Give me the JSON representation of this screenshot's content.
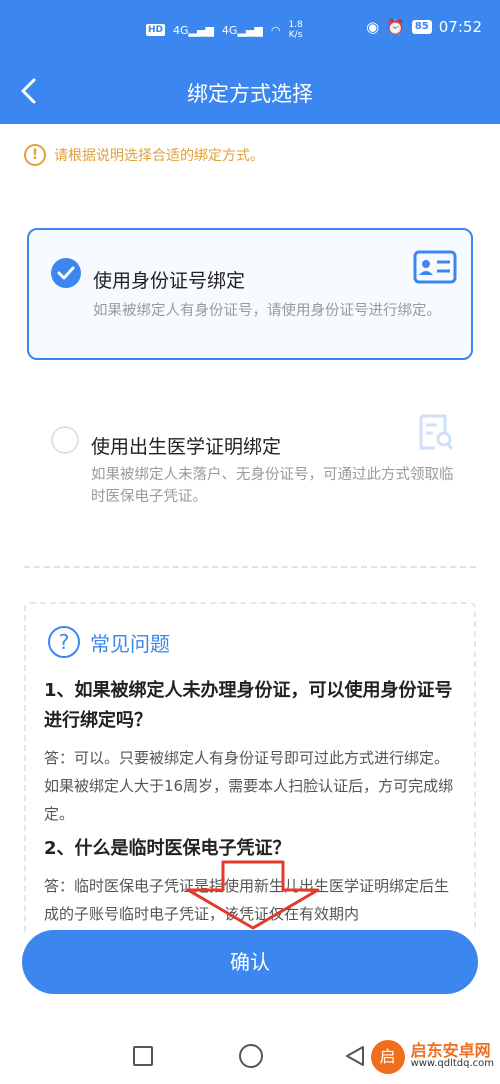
{
  "status_bar": {
    "network": "HD 4G 4G",
    "speed_value": "1.8",
    "speed_unit": "K/s",
    "battery": "85",
    "time": "07:52"
  },
  "header": {
    "title": "绑定方式选择"
  },
  "notice": {
    "text": "请根据说明选择合适的绑定方式。",
    "icon_text": "!"
  },
  "options": [
    {
      "title": "使用身份证号绑定",
      "desc": "如果被绑定人有身份证号，请使用身份证号进行绑定。",
      "selected": true
    },
    {
      "title": "使用出生医学证明绑定",
      "desc": "如果被绑定人未落户、无身份证号，可通过此方式领取临时医保电子凭证。",
      "selected": false
    }
  ],
  "faq": {
    "title": "常见问题",
    "icon_text": "?",
    "items": [
      {
        "q": "1、如果被绑定人未办理身份证，可以使用身份证号进行绑定吗？",
        "a": "答：可以。只要被绑定人有身份证号即可过此方式进行绑定。如果被绑定人大于16周岁，需要本人扫脸认证后，方可完成绑定。"
      },
      {
        "q": "2、什么是临时医保电子凭证？",
        "a": "答：临时医保电子凭证是指使用新生儿出生医学证明绑定后生成的子账号临时电子凭证，该凭证仅在有效期内"
      }
    ]
  },
  "confirm_button": {
    "label": "确认"
  },
  "watermark": {
    "name": "启东安卓网",
    "url": "www.qdltdq.com",
    "logo_char": "启"
  },
  "colors": {
    "primary": "#3b87ef",
    "notice": "#e0a13a",
    "annotation": "#e23b2e"
  }
}
